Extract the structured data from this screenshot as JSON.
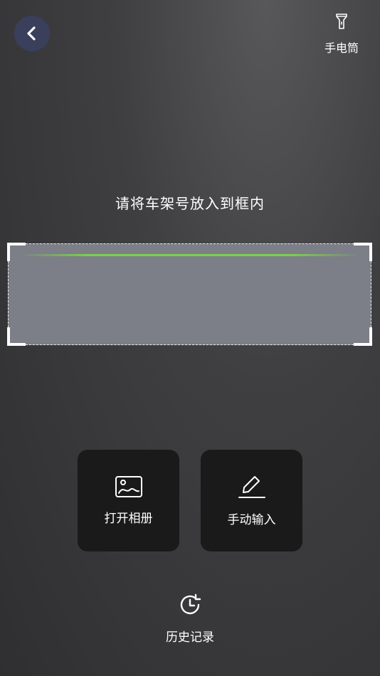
{
  "header": {
    "torch_label": "手电筒"
  },
  "scanner": {
    "hint": "请将车架号放入到框内"
  },
  "actions": [
    {
      "label": "打开相册",
      "icon": "image-icon"
    },
    {
      "label": "手动输入",
      "icon": "pencil-icon"
    }
  ],
  "footer": {
    "history_label": "历史记录",
    "icon": "history-clock-icon"
  },
  "colors": {
    "scan_line": "#7bd14a",
    "back_button": "#3a3f5c",
    "card_bg": "#1a1a1b"
  }
}
